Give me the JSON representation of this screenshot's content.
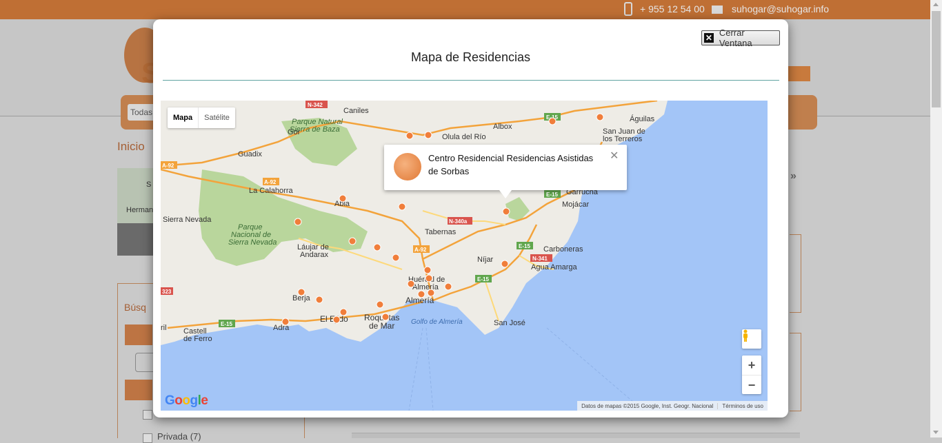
{
  "site": {
    "phone": "+ 955 12 54 00",
    "email": "suhogar@suhogar.info",
    "nav_select": "Todas",
    "breadcrumb": "Inicio",
    "sidebar_title": "Búsq",
    "privada_label": "Privada (7)",
    "map_label_s": "S",
    "map_label_herm": "Herman",
    "arrows": "»"
  },
  "modal": {
    "close_label": "Cerrar Ventana",
    "title": "Mapa de Residencias"
  },
  "map": {
    "type_options": [
      "Mapa",
      "Satélite"
    ],
    "selected_type": "Mapa",
    "zoom_in": "+",
    "zoom_out": "−",
    "google": "Google",
    "attribution": "Datos de mapas ©2015 Google, Inst. Geogr. Nacional",
    "terms": "Términos de uso",
    "infowindow_title": "Centro Residencial Residencias Asistidas de Sorbas",
    "place_labels": [
      "Caniles",
      "Parque Natural",
      "Sierra de Baza",
      "Olula del Río",
      "Albox",
      "Águilas",
      "San Juan de",
      "los Terreros",
      "Gor",
      "Guadix",
      "La Calahorra",
      "Abla",
      "Sierra Nevada",
      "Parque",
      "Nacional de",
      "Sierra Nevada",
      "Láujar de",
      "Andarax",
      "Tabernas",
      "Garrucha",
      "Mojácar",
      "Carboneras",
      "Agua Amarga",
      "Níjar",
      "Huércal de",
      "Almería",
      "Almería",
      "Golfo de Almería",
      "San José",
      "Roquetas",
      "de Mar",
      "El Ejido",
      "Berja",
      "Adra",
      "Castell",
      "de Ferro",
      "ril"
    ],
    "road_labels": [
      "N-342",
      "A-92",
      "A-92",
      "E-15",
      "E-15",
      "N-340a",
      "A-92",
      "E-15",
      "N-341",
      "E-15",
      "E-15",
      "323"
    ],
    "colors": {
      "water": "#a3c5f7",
      "land": "#eeece6",
      "park": "#b9d69c",
      "highway": "#f3a33b",
      "marker": "#f07e3b"
    }
  }
}
